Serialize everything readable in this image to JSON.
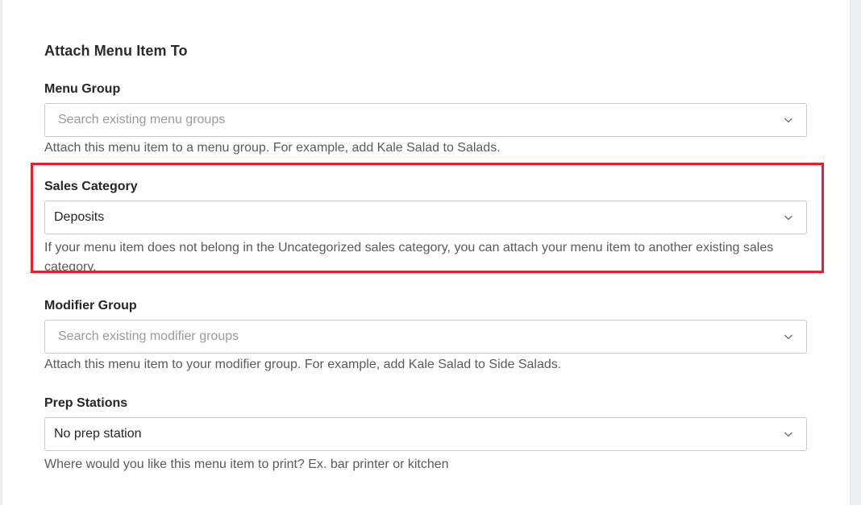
{
  "section": {
    "title": "Attach Menu Item To"
  },
  "menu_group": {
    "label": "Menu Group",
    "placeholder": "Search existing menu groups",
    "help": "Attach this menu item to a menu group. For example, add Kale Salad to Salads."
  },
  "sales_category": {
    "label": "Sales Category",
    "value": "Deposits",
    "help": "If your menu item does not belong in the Uncategorized sales category, you can attach your menu item to another existing sales category."
  },
  "modifier_group": {
    "label": "Modifier Group",
    "placeholder": "Search existing modifier groups",
    "help": "Attach this menu item to your modifier group. For example, add Kale Salad to Side Salads."
  },
  "prep_stations": {
    "label": "Prep Stations",
    "value": "No prep station",
    "help": "Where would you like this menu item to print? Ex. bar printer or kitchen"
  },
  "colors": {
    "highlight": "#e2212f",
    "border": "#c8c8c8",
    "placeholder": "#9a9a9a"
  },
  "icons": {
    "dropdown": "chevron-down-icon"
  }
}
